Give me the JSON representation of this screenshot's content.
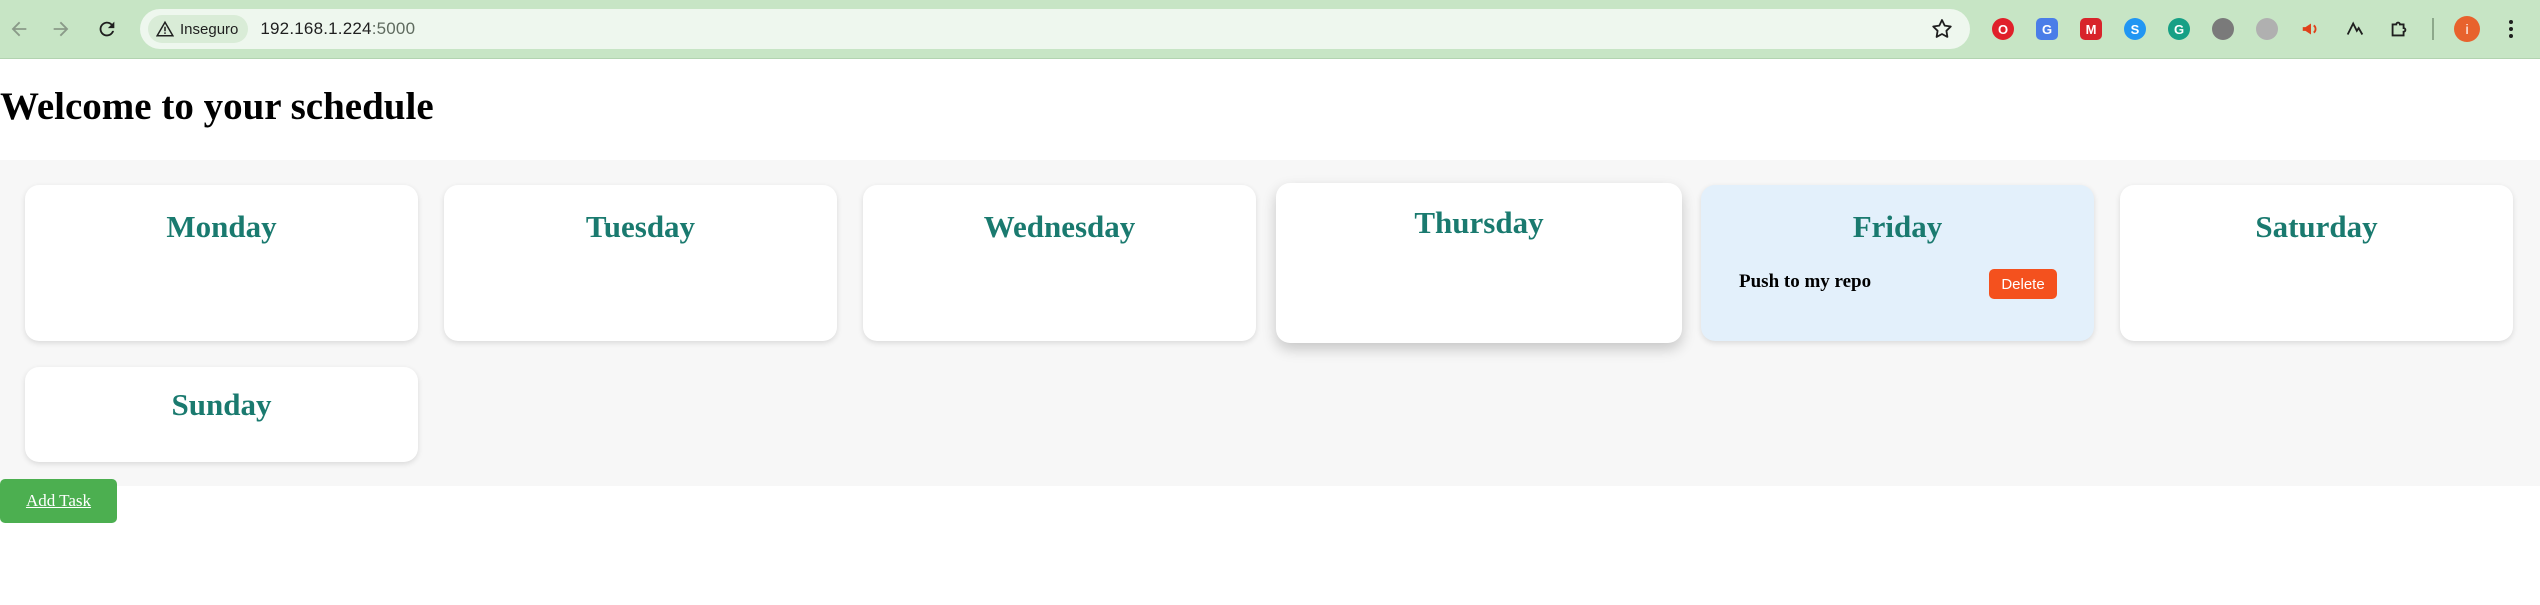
{
  "browser": {
    "security_label": "Inseguro",
    "url_host": "192.168.1.224",
    "url_port": ":5000",
    "profile_initial": "i",
    "extensions": [
      {
        "name": "opera-icon",
        "color": "#e0202a"
      },
      {
        "name": "translate-icon",
        "color": "#4a7de8"
      },
      {
        "name": "mega-icon",
        "color": "#d8242b"
      },
      {
        "name": "sync-icon",
        "color": "#2196f3"
      },
      {
        "name": "grammarly-icon",
        "color": "#16a085"
      },
      {
        "name": "circle-ext-icon",
        "color": "#7a7a7a"
      },
      {
        "name": "mouse-ext-icon",
        "color": "#9a9a9a"
      },
      {
        "name": "megaphone-icon",
        "color": "#e0401a"
      },
      {
        "name": "script-ext-icon",
        "color": "#1f1f1f"
      },
      {
        "name": "puzzle-icon",
        "color": "#1f1f1f"
      }
    ]
  },
  "page": {
    "title": "Welcome to your schedule"
  },
  "days": [
    {
      "name": "Monday",
      "tasks": []
    },
    {
      "name": "Tuesday",
      "tasks": []
    },
    {
      "name": "Wednesday",
      "tasks": []
    },
    {
      "name": "Thursday",
      "tasks": []
    },
    {
      "name": "Friday",
      "tasks": [
        {
          "text": "Push to my repo",
          "delete_label": "Delete"
        }
      ]
    },
    {
      "name": "Saturday",
      "tasks": []
    },
    {
      "name": "Sunday",
      "tasks": []
    }
  ],
  "actions": {
    "add_task_label": "Add Task"
  },
  "colors": {
    "day_title": "#1a7a6f",
    "delete_button": "#f4511e",
    "add_task_button": "#4caf50",
    "friday_highlight": "#e3f0fb",
    "browser_frame": "#c7e5c5"
  }
}
